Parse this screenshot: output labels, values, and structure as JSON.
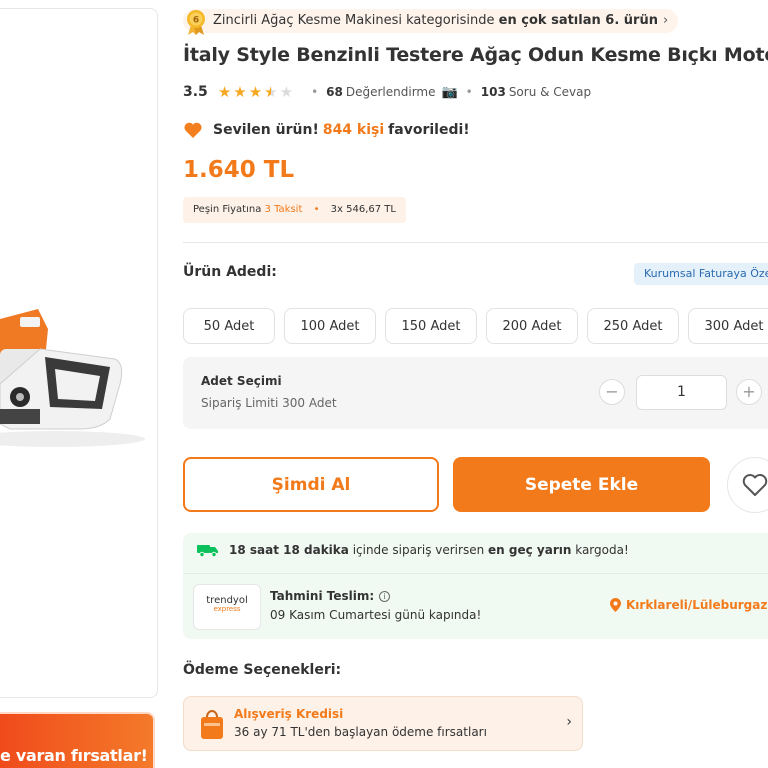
{
  "promo": {
    "text": "e varan fırsatlar!"
  },
  "bestseller": {
    "rank_icon_number": "6",
    "prefix": "Zincirli Ağaç Kesme Makinesi kategorisinde ",
    "highlight": "en çok satılan 6. ürün",
    "chevron": "›"
  },
  "product": {
    "brand": "İtaly Style",
    "name": " Benzinli Testere Ağaç Odun Kesme Bıçkı Motoru"
  },
  "rating": {
    "score": "3.5",
    "stars": 3.5,
    "review_count": "68",
    "review_label": "Değerlendirme",
    "qa_count": "103",
    "qa_label": "Soru & Cevap"
  },
  "favorite": {
    "prefix": "Sevilen ürün!",
    "count": "844 kişi",
    "suffix": "favoriledi!"
  },
  "price": {
    "value": "1.640 TL"
  },
  "installment": {
    "prefix": "Peşin Fiyatına",
    "highlight": "3 Taksit",
    "separator": "•",
    "amount": "3x 546,67 TL"
  },
  "quantity": {
    "label": "Ürün Adedi:",
    "corporate_badge": "Kurumsal Faturaya Öze",
    "options": [
      "50 Adet",
      "100 Adet",
      "150 Adet",
      "200 Adet",
      "250 Adet",
      "300 Adet"
    ],
    "selection_title": "Adet Seçimi",
    "limit_text": "Sipariş Limiti 300 Adet",
    "value": "1",
    "minus": "−",
    "plus": "+"
  },
  "actions": {
    "buy_now": "Şimdi Al",
    "add_to_cart": "Sepete Ekle"
  },
  "delivery": {
    "time_bold": "18 saat 18 dakika",
    "time_mid": " içinde sipariş verirsen ",
    "time_bold2": "en geç yarın",
    "time_end": " kargoda!",
    "logo_line1": "trendyol",
    "logo_line2": "express",
    "estimate_label": "Tahmini Teslim:",
    "estimate_date": "09 Kasım Cumartesi günü kapında!",
    "location": "Kırklareli/Lüleburgaz"
  },
  "payment": {
    "label": "Ödeme Seçenekleri:",
    "card_title": "Alışveriş Kredisi",
    "card_text": "36 ay 71 TL'den başlayan ödeme fırsatları"
  },
  "colors": {
    "accent": "#f27a1a",
    "star": "#f7a823",
    "star_empty": "#dcdcdc",
    "delivery_bg": "#f1f9f3",
    "truck": "#0bc15c"
  }
}
